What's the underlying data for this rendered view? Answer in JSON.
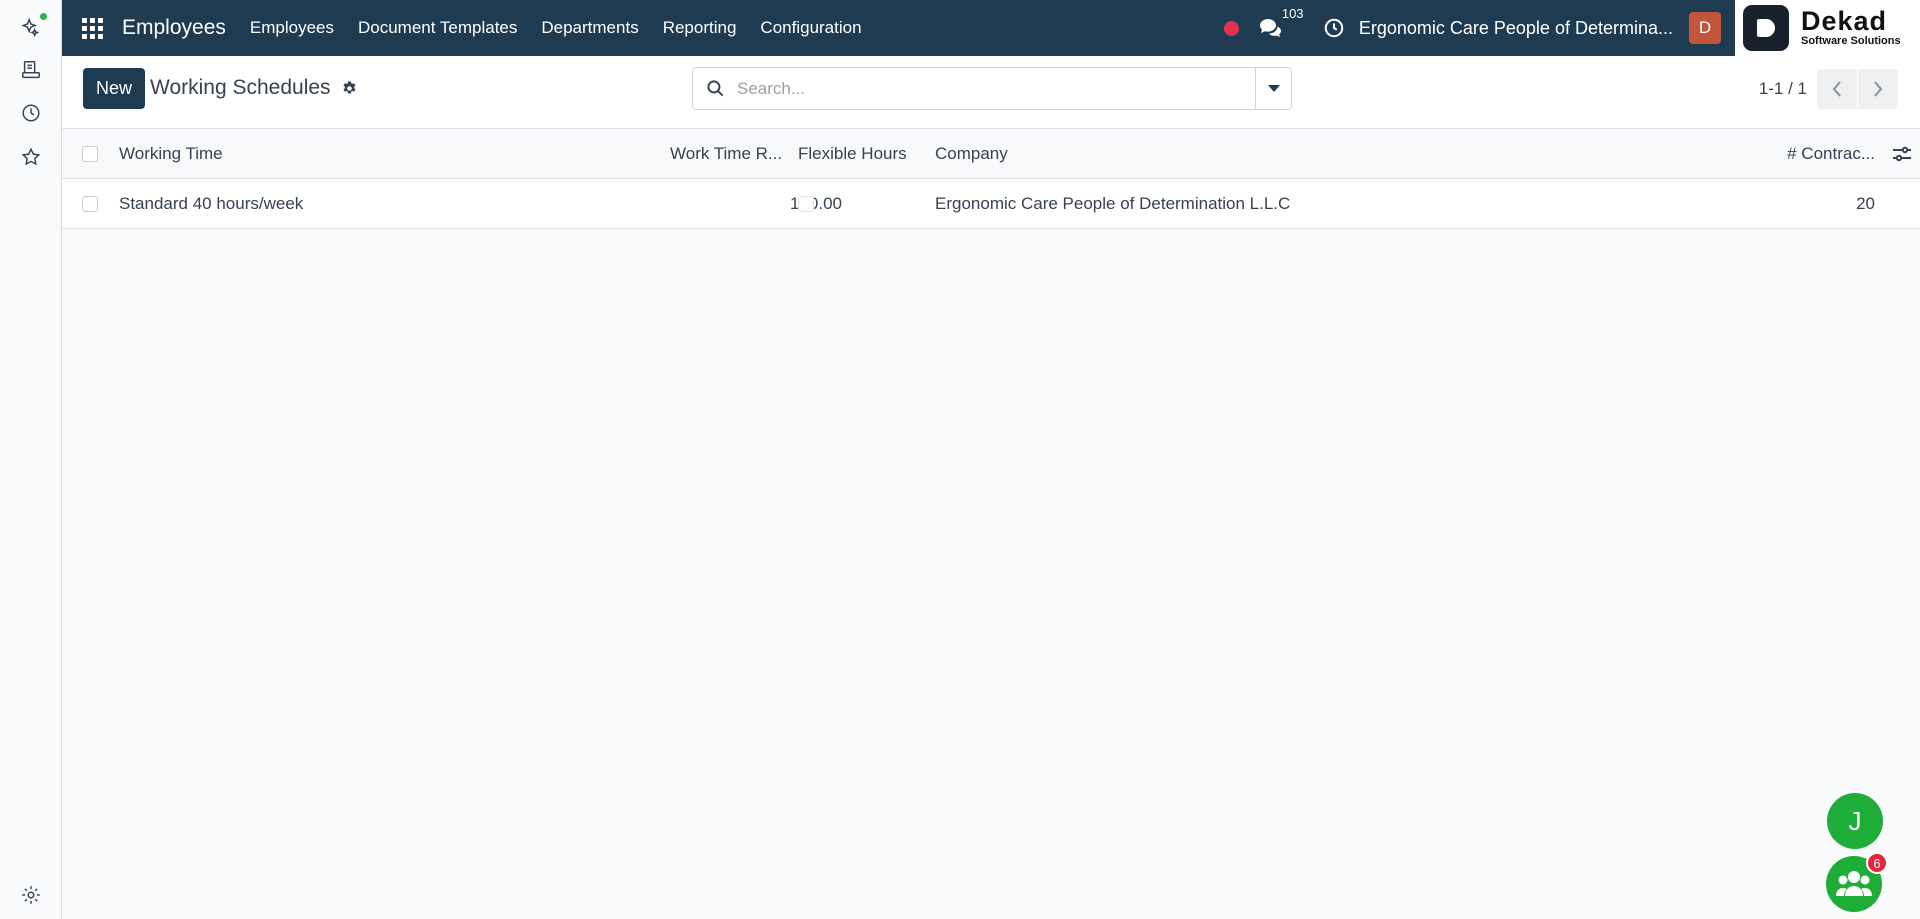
{
  "navbar": {
    "app_title": "Employees",
    "menu": [
      "Employees",
      "Document Templates",
      "Departments",
      "Reporting",
      "Configuration"
    ],
    "messages_count": "103",
    "company": "Ergonomic Care People of Determina...",
    "user_initial": "D"
  },
  "brand": {
    "name": "Dekad",
    "tagline": "Software Solutions"
  },
  "control_panel": {
    "new_label": "New",
    "breadcrumb": "Working Schedules",
    "search_placeholder": "Search...",
    "pager": "1-1 / 1"
  },
  "list": {
    "columns": [
      "Working Time",
      "Work Time R...",
      "Flexible Hours",
      "Company",
      "# Contrac..."
    ],
    "rows": [
      {
        "working_time": "Standard 40 hours/week",
        "work_time_rate": "100.00",
        "flexible_hours": false,
        "company": "Ergonomic Care People of Determination L.L.C",
        "contracts": "20"
      }
    ]
  },
  "floating": {
    "user_bubble": "J",
    "chat_badge": "6"
  },
  "colors": {
    "navbar": "#1f3b52",
    "primary_button": "#1f3b52",
    "record_dot": "#e4314b",
    "avatar": "#c2553a",
    "fab": "#1fad3a",
    "badge": "#e0283e"
  },
  "icons": {
    "rail": [
      "ai-sparkle-icon",
      "activity-icon",
      "clock-icon",
      "star-icon",
      "settings-icon"
    ],
    "navbar": [
      "apps-grid-icon",
      "record-icon",
      "chat-icon",
      "clock-icon"
    ]
  }
}
